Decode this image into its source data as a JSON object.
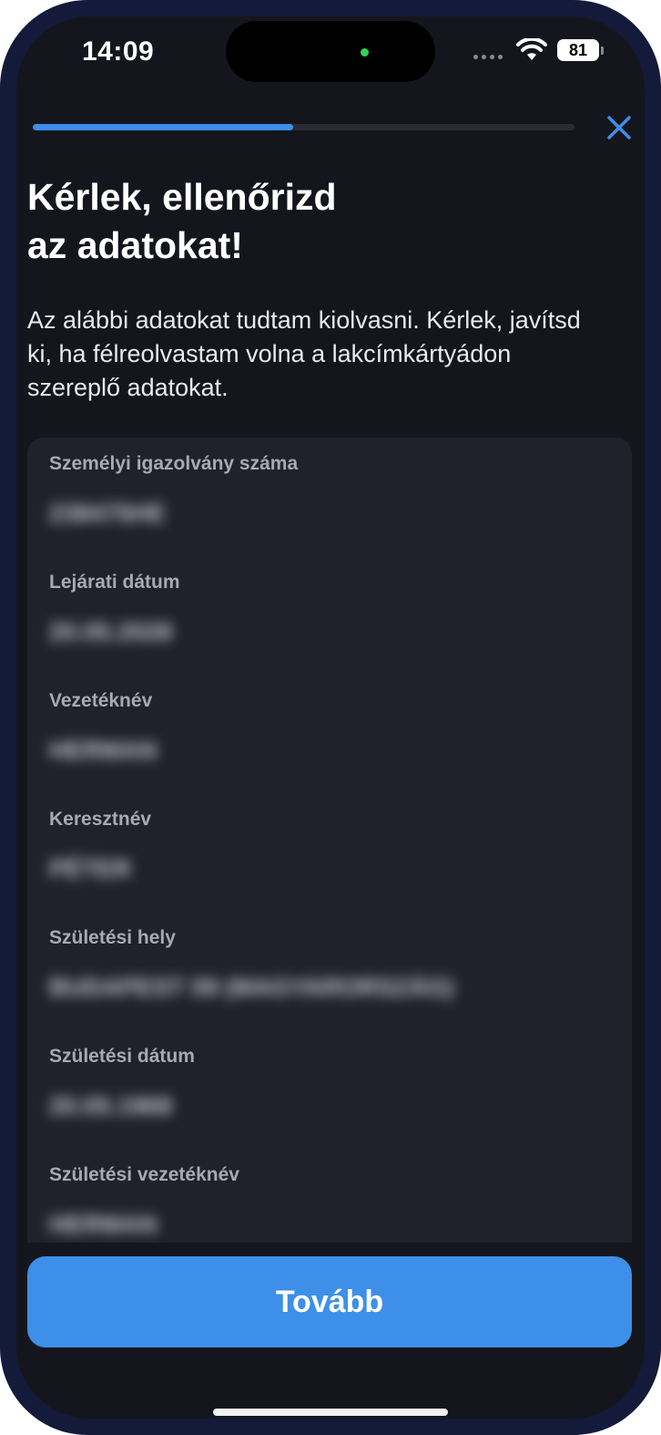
{
  "status_bar": {
    "time": "14:09",
    "battery": "81",
    "camera_dot_color": "#30d158"
  },
  "progress": {
    "value": 0.48,
    "accent": "#3d8fe8"
  },
  "close_icon": "close-icon",
  "title_line1": "Kérlek, ellenőrizd",
  "title_line2": "az adatokat!",
  "subtitle": "Az alábbi adatokat tudtam kiolvasni. Kérlek, javítsd ki, ha félreolvastam volna a lakcímkártyádon szereplő adatokat.",
  "fields": [
    {
      "label": "Személyi igazolvány száma",
      "value": "238475HE"
    },
    {
      "label": "Lejárati dátum",
      "value": "20.05.2028"
    },
    {
      "label": "Vezetéknév",
      "value": "HERMAN"
    },
    {
      "label": "Keresztnév",
      "value": "PÉTER"
    },
    {
      "label": "Születési hely",
      "value": "BUDAPEST 09 (MAGYARORSZÁG)"
    },
    {
      "label": "Születési dátum",
      "value": "20.05.1968"
    },
    {
      "label": "Születési vezetéknév",
      "value": "HERMAN"
    }
  ],
  "continue_button": {
    "label": "Tovább",
    "color": "#3d8fe8"
  }
}
